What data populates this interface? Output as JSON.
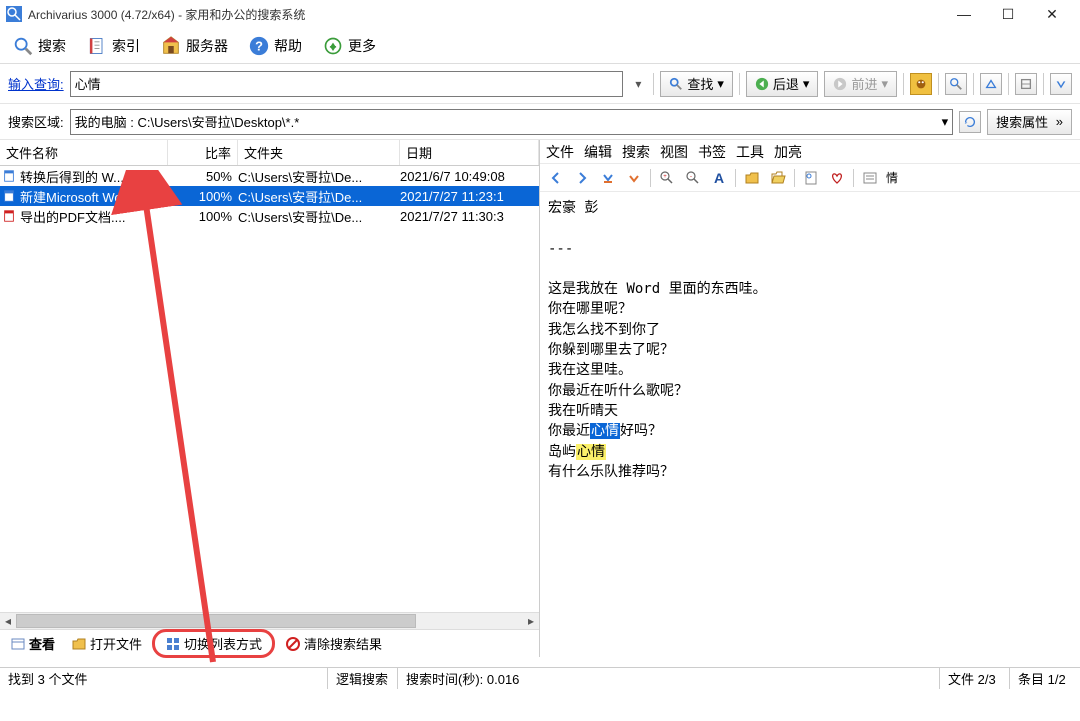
{
  "title": "Archivarius 3000 (4.72/x64) - 家用和办公的搜索系统",
  "toolbar": {
    "search": "搜索",
    "index": "索引",
    "server": "服务器",
    "help": "帮助",
    "more": "更多"
  },
  "query": {
    "label": "输入查询:",
    "value": "心情",
    "find": "查找",
    "back": "后退",
    "forward": "前进"
  },
  "scope": {
    "label": "搜索区域:",
    "value": "我的电脑 : C:\\Users\\安哥拉\\Desktop\\*.*",
    "props": "搜索属性"
  },
  "cols": {
    "name": "文件名称",
    "rate": "比率",
    "folder": "文件夹",
    "date": "日期"
  },
  "rows": [
    {
      "icon": "doc",
      "name": "转换后得到的 W...",
      "rate": "50%",
      "folder": "C:\\Users\\安哥拉\\De...",
      "date": "2021/6/7 10:49:08",
      "selected": false
    },
    {
      "icon": "doc",
      "name": "新建Microsoft Wo...",
      "rate": "100%",
      "folder": "C:\\Users\\安哥拉\\De...",
      "date": "2021/7/27 11:23:1",
      "selected": true
    },
    {
      "icon": "pdf",
      "name": "导出的PDF文档....",
      "rate": "100%",
      "folder": "C:\\Users\\安哥拉\\De...",
      "date": "2021/7/27 11:30:3",
      "selected": false
    }
  ],
  "left_buttons": {
    "view": "查看",
    "open": "打开文件",
    "toggle": "切换列表方式",
    "clear": "清除搜索结果"
  },
  "menu": [
    "文件",
    "编辑",
    "搜索",
    "视图",
    "书签",
    "工具",
    "加亮"
  ],
  "preview": {
    "l1": "宏豪 彭",
    "divider": "---",
    "l2_pre": "这是我放在 ",
    "l2_mid": "Word",
    "l2_post": " 里面的东西哇。",
    "l3": "你在哪里呢？",
    "l4": "我怎么找不到你了",
    "l5": "你躲到哪里去了呢？",
    "l6": "我在这里哇。",
    "l7": "你最近在听什么歌呢？",
    "l8": "我在听晴天",
    "l9_pre": "你最近",
    "l9_hl": "心情",
    "l9_post": "好吗？",
    "l10_pre": "岛屿",
    "l10_hl": "心情",
    "l11": "有什么乐队推荐吗？",
    "heart_label": "情"
  },
  "status": {
    "found": "找到 3 个文件",
    "logic": "逻辑搜索",
    "time": "搜索时间(秒): 0.016",
    "file": "文件 2/3",
    "item": "条目 1/2"
  }
}
